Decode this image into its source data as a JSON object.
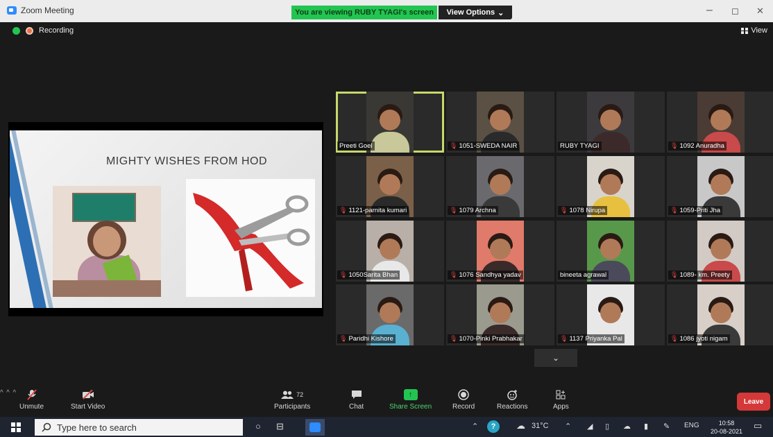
{
  "window": {
    "title": "Zoom Meeting",
    "share_banner": "You are viewing RUBY TYAGI's screen",
    "view_options": "View Options",
    "view_options_caret": "⌄",
    "minimize": "–",
    "maximize": "◻",
    "close": "✕"
  },
  "status": {
    "recording_label": "Recording",
    "view_label": "View"
  },
  "slide": {
    "title": "MIGHTY WISHES FROM HOD"
  },
  "participants": [
    {
      "name": "Preeti Goel",
      "muted": false,
      "active": true
    },
    {
      "name": "1051-SWEDA NAIR",
      "muted": true
    },
    {
      "name": "RUBY TYAGI",
      "muted": false
    },
    {
      "name": "1092 Anuradha",
      "muted": true
    },
    {
      "name": "1121-parnita kumari",
      "muted": true
    },
    {
      "name": "1079 Archna",
      "muted": true
    },
    {
      "name": "1078 Nirupa",
      "muted": true
    },
    {
      "name": "1059-Priti Jha",
      "muted": true
    },
    {
      "name": "1050Sarita Bhan",
      "muted": true
    },
    {
      "name": "1076 Sandhya yadav",
      "muted": true
    },
    {
      "name": "bineeta agrawal",
      "muted": false
    },
    {
      "name": "1089- km. Preety",
      "muted": true
    },
    {
      "name": "Paridhi Kishore",
      "muted": true
    },
    {
      "name": "1070-Pinki Prabhakar",
      "muted": true
    },
    {
      "name": "1137 Priyanka Pal",
      "muted": true
    },
    {
      "name": "1086 jyoti nigam",
      "muted": true
    }
  ],
  "toolbar": {
    "unmute": "Unmute",
    "start_video": "Start Video",
    "participants": "Participants",
    "participant_count": "72",
    "chat": "Chat",
    "share_screen": "Share Screen",
    "record": "Record",
    "reactions": "Reactions",
    "apps": "Apps",
    "leave": "Leave",
    "more_caret": "^",
    "scroll_down": "⌄"
  },
  "taskbar": {
    "search_placeholder": "Type here to search",
    "temperature": "31°C",
    "language": "ENG",
    "time": "10:58",
    "date": "20-08-2021"
  },
  "colors": {
    "share_green": "#23c552",
    "leave_red": "#d43838",
    "active_outline": "#c7d96a",
    "zoom_blue": "#2d8cff"
  }
}
